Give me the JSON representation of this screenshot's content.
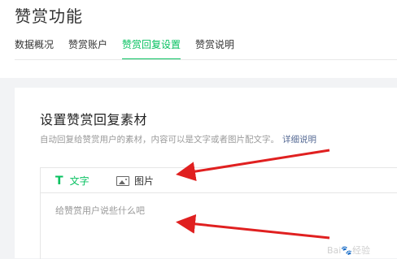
{
  "page": {
    "title": "赞赏功能"
  },
  "tabs": [
    {
      "label": "数据概况"
    },
    {
      "label": "赞赏账户"
    },
    {
      "label": "赞赏回复设置"
    },
    {
      "label": "赞赏说明"
    }
  ],
  "active_tab": "赞赏回复设置",
  "section": {
    "title": "设置赞赏回复素材",
    "description": "自动回复给赞赏用户的素材，内容可以是文字或者图片配文字。",
    "detail_link": "详细说明"
  },
  "editor": {
    "toolbar": {
      "text_label": "文字",
      "text_icon_glyph": "T",
      "image_label": "图片"
    },
    "placeholder": "给赞赏用户说些什么吧"
  },
  "watermark": "Bai🐾经验",
  "colors": {
    "accent": "#07c160",
    "link": "#576b95",
    "annotation_arrow": "#e02020"
  },
  "icons": [
    "text-icon",
    "image-icon"
  ]
}
